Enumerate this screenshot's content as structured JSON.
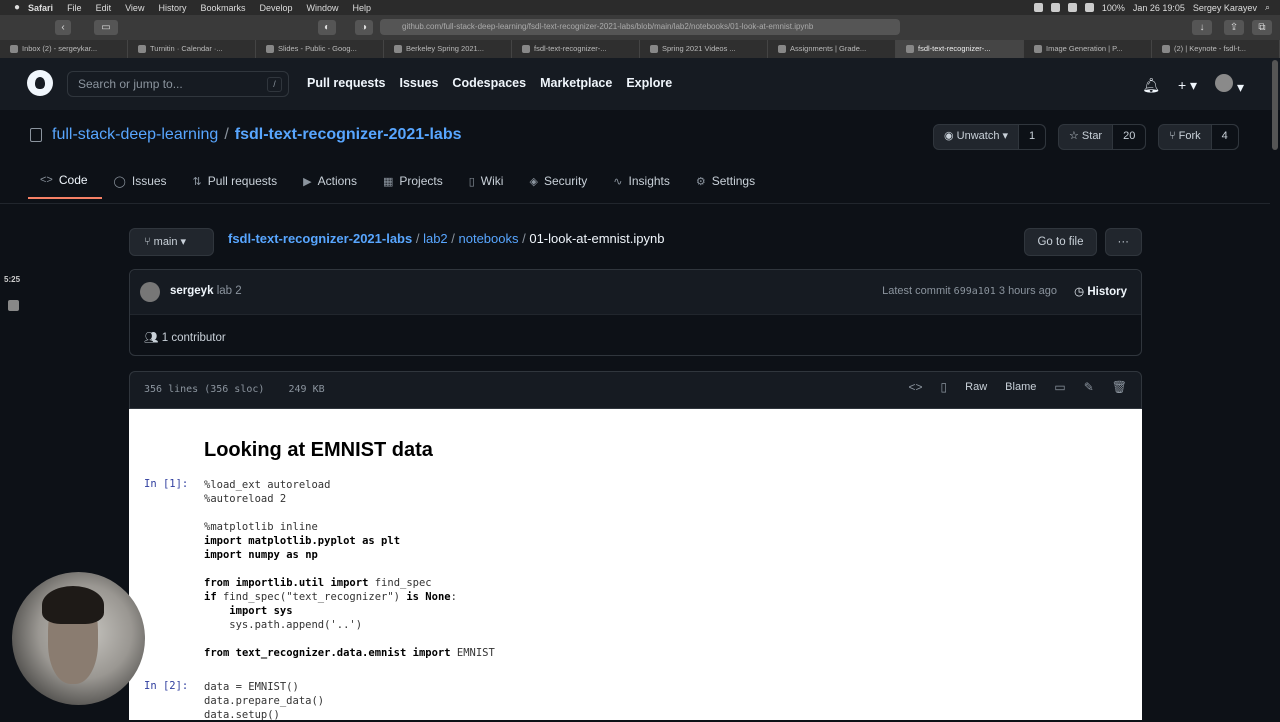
{
  "mac_menu": {
    "items": [
      "Safari",
      "File",
      "Edit",
      "View",
      "History",
      "Bookmarks",
      "Develop",
      "Window",
      "Help"
    ],
    "battery": "100%",
    "datetime": "Jan 26  19:05",
    "user": "Sergey Karayev"
  },
  "browser": {
    "url": "github.com/full-stack-deep-learning/fsdl-text-recognizer-2021-labs/blob/main/lab2/notebooks/01-look-at-emnist.ipynb",
    "tabs": [
      {
        "label": "Inbox (2) - sergeykar...",
        "active": false
      },
      {
        "label": "Turnitin · Calendar ·...",
        "active": false
      },
      {
        "label": "Slides - Public - Goog...",
        "active": false
      },
      {
        "label": "Berkeley Spring 2021...",
        "active": false
      },
      {
        "label": "fsdl-text-recognizer-...",
        "active": false
      },
      {
        "label": "Spring 2021 Videos ...",
        "active": false
      },
      {
        "label": "Assignments | Grade...",
        "active": false
      },
      {
        "label": "fsdl-text-recognizer-...",
        "active": true
      },
      {
        "label": "Image Generation | P...",
        "active": false
      },
      {
        "label": "(2) | Keynote - fsdl-t...",
        "active": false
      }
    ]
  },
  "gh_header": {
    "search_placeholder": "Search or jump to...",
    "search_shortcut": "/",
    "nav": [
      "Pull requests",
      "Issues",
      "Codespaces",
      "Marketplace",
      "Explore"
    ]
  },
  "repo": {
    "owner": "full-stack-deep-learning",
    "name": "fsdl-text-recognizer-2021-labs",
    "watch_label": "Unwatch",
    "watch_count": "1",
    "star_label": "Star",
    "star_count": "20",
    "fork_label": "Fork",
    "fork_count": "4",
    "tabs": [
      {
        "label": "Code",
        "icon": "<>"
      },
      {
        "label": "Issues",
        "icon": "◯"
      },
      {
        "label": "Pull requests",
        "icon": "⇅"
      },
      {
        "label": "Actions",
        "icon": "▶"
      },
      {
        "label": "Projects",
        "icon": "▦"
      },
      {
        "label": "Wiki",
        "icon": "▯"
      },
      {
        "label": "Security",
        "icon": "◈"
      },
      {
        "label": "Insights",
        "icon": "∿"
      },
      {
        "label": "Settings",
        "icon": "⚙"
      }
    ]
  },
  "file": {
    "branch": "main",
    "crumb_repo": "fsdl-text-recognizer-2021-labs",
    "crumb_dir1": "lab2",
    "crumb_dir2": "notebooks",
    "crumb_file": "01-look-at-emnist.ipynb",
    "goto_label": "Go to file",
    "more_label": "···",
    "author": "sergeyk",
    "commit_msg": "lab 2",
    "latest_label": "Latest commit",
    "sha": "699a101",
    "time": "3 hours ago",
    "history_label": "History",
    "contributors": "1 contributor",
    "lines": "356 lines (356 sloc)",
    "size": "249 KB",
    "raw_label": "Raw",
    "blame_label": "Blame"
  },
  "notebook": {
    "title": "Looking at EMNIST data",
    "cell1_prompt": "In [1]:",
    "cell2_prompt": "In [2]:"
  },
  "overlay": {
    "timer": "5:25"
  }
}
